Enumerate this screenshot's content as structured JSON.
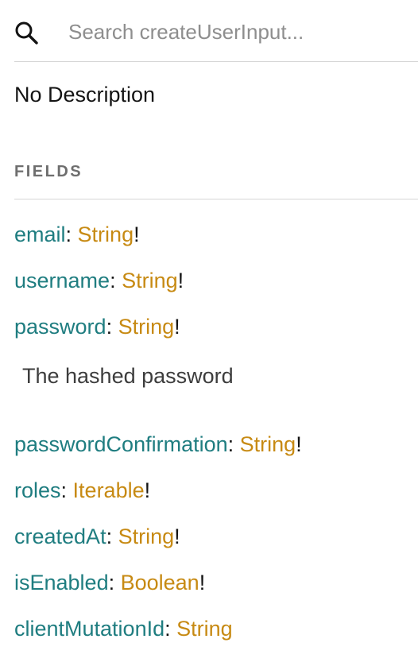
{
  "search": {
    "placeholder": "Search createUserInput..."
  },
  "description": "No Description",
  "fields_section": {
    "title": "FIELDS",
    "items": [
      {
        "name": "email",
        "separator": ": ",
        "type": "String",
        "suffix": "!"
      },
      {
        "name": "username",
        "separator": ": ",
        "type": "String",
        "suffix": "!"
      },
      {
        "name": "password",
        "separator": ": ",
        "type": "String",
        "suffix": "!",
        "description": "The hashed password"
      },
      {
        "name": "passwordConfirmation",
        "separator": ": ",
        "type": "String",
        "suffix": "!"
      },
      {
        "name": "roles",
        "separator": ": ",
        "type": "Iterable",
        "suffix": "!"
      },
      {
        "name": "createdAt",
        "separator": ": ",
        "type": "String",
        "suffix": "!"
      },
      {
        "name": "isEnabled",
        "separator": ": ",
        "type": "Boolean",
        "suffix": "!"
      },
      {
        "name": "clientMutationId",
        "separator": ": ",
        "type": "String",
        "suffix": ""
      }
    ]
  },
  "colors": {
    "field_name": "#1f7d80",
    "type_name": "#c78a13",
    "section_title": "#6e6e6e",
    "divider": "#d6d6d6"
  },
  "icons": {
    "search": "search-icon"
  }
}
